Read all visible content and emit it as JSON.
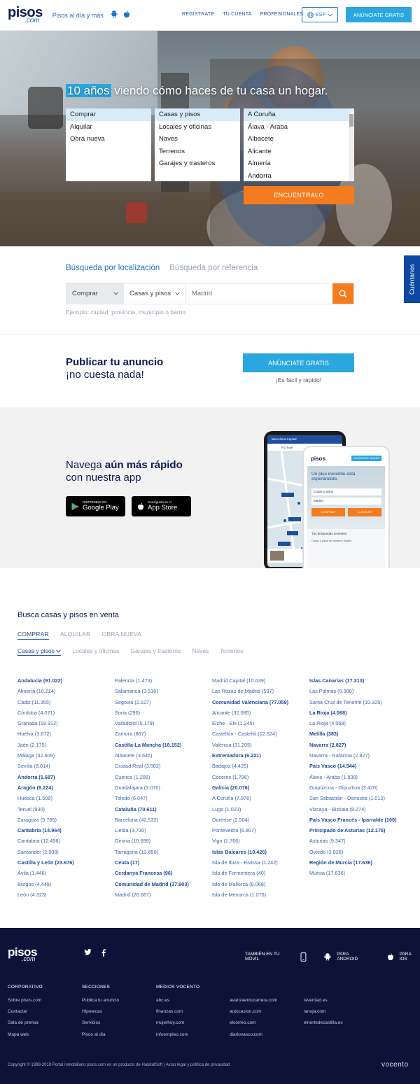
{
  "header": {
    "logo": "pisos",
    "logo_sub": ".com",
    "tagline": "Pisos al día y más",
    "links": [
      "REGÍSTRATE",
      "TU CUENTA",
      "PROFESIONALES"
    ],
    "language": "ESP",
    "cta": "ANÚNCIATE GRATIS"
  },
  "hero": {
    "title_hl": "10 años",
    "title_rest": " viendo cómo haces de tu casa un hogar.",
    "operation_options": [
      "Comprar",
      "Alquilar",
      "Obra nueva"
    ],
    "type_options": [
      "Casas y pisos",
      "Locales y oficinas",
      "Naves",
      "Terrenos",
      "Garajes y trasteros"
    ],
    "province_options": [
      "A Coruña",
      "Álava - Araba",
      "Albacete",
      "Alicante",
      "Almería",
      "Andorra"
    ],
    "find_button": "ENCUÉNTRALO"
  },
  "search": {
    "tab_location_a": "Búsqueda",
    "tab_location_b": " por localización",
    "tab_reference": "Búsqueda por referencia",
    "operation": "Comprar",
    "type": "Casas y pisos",
    "placeholder": "Madrid",
    "hint": "Ejemplo: ciudad, provincia, municipio o barrio"
  },
  "side_tab": "Cuéntanos",
  "publish": {
    "title": "Publicar tu anuncio",
    "subtitle": "¡no cuesta nada!",
    "button": "ANÚNCIATE GRATIS",
    "note": "¡Es fácil y rápido!"
  },
  "app": {
    "line1_a": "Navega ",
    "line1_b": "aún más rápido",
    "line2": "con nuestra app",
    "google_small": "DISPONIBLE EN",
    "google_big": "Google Play",
    "apple_small": "Consíguela en el",
    "apple_big": "App Store",
    "phone_back_search": "Barcelona Capital",
    "phone_back_filter": "FILTRAR",
    "phone_front_logo": "pisos",
    "phone_front_cta": "ANÚNCIATE GRATIS",
    "phone_front_headline": "Un piso increíble está esperándote.",
    "phone_front_type": "Casas y pisos",
    "phone_front_city": "Madrid",
    "phone_front_buy": "COMPRAR",
    "phone_front_rent": "ALQUILAR",
    "phone_front_recent": "Tus búsquedas recientes",
    "phone_front_recent_item": "Casas y pisos en venta en Madrid"
  },
  "listing": {
    "title": "Busca casas y pisos en venta",
    "tabs": [
      "COMPRAR",
      "ALQUILAR",
      "OBRA NUEVA"
    ],
    "subtabs": [
      "Casas y pisos",
      "Locales y oficinas",
      "Garajes y trasteros",
      "Naves",
      "Terrenos"
    ],
    "columns": [
      [
        {
          "t": "Andalucía (91.022)",
          "b": true
        },
        {
          "t": "Almería (10.214)"
        },
        {
          "t": "Cádiz (11.355)"
        },
        {
          "t": "Córdoba (4.071)"
        },
        {
          "t": "Granada (18.912)"
        },
        {
          "t": "Huelva (3.672)"
        },
        {
          "t": "Jaén (2.175)"
        },
        {
          "t": "Málaga (32.609)"
        },
        {
          "t": "Sevilla (8.014)"
        },
        {
          "t": "Andorra (1.687)",
          "b": true
        },
        {
          "t": "Aragón (8.224)",
          "b": true
        },
        {
          "t": "Huesca (1.509)"
        },
        {
          "t": "Teruel (930)"
        },
        {
          "t": "Zaragoza (5.785)"
        },
        {
          "t": "Cantabria (14.964)",
          "b": true
        },
        {
          "t": "Cantabria (12.456)"
        },
        {
          "t": "Santander (2.508)"
        },
        {
          "t": "Castilla y León (23.676)",
          "b": true
        },
        {
          "t": "Ávila (1.446)"
        },
        {
          "t": "Burgos (4.449)"
        },
        {
          "t": "León (4.323)"
        }
      ],
      [
        {
          "t": "Palencia (1.473)"
        },
        {
          "t": "Salamanca (3.516)"
        },
        {
          "t": "Segovia (2.127)"
        },
        {
          "t": "Soria (296)"
        },
        {
          "t": "Valladolid (5.179)"
        },
        {
          "t": "Zamora (867)"
        },
        {
          "t": "Castilla-La Mancha (18.152)",
          "b": true
        },
        {
          "t": "Albacete (3.645)"
        },
        {
          "t": "Ciudad Real (3.582)"
        },
        {
          "t": "Cuenca (1.208)"
        },
        {
          "t": "Guadalajara (3.070)"
        },
        {
          "t": "Toledo (6.647)"
        },
        {
          "t": "Cataluña (70.611)",
          "b": true
        },
        {
          "t": "Barcelona (42.532)"
        },
        {
          "t": "Lleida (3.730)"
        },
        {
          "t": "Girona (10.699)"
        },
        {
          "t": "Tarragona (13.650)"
        },
        {
          "t": "Ceuta (17)",
          "b": true
        },
        {
          "t": "Cerdanya Francesa (96)",
          "b": true
        },
        {
          "t": "Comunidad de Madrid (37.903)",
          "b": true
        },
        {
          "t": "Madrid (26.667)"
        }
      ],
      [
        {
          "t": "Madrid Capital (10.639)"
        },
        {
          "t": "Las Rozas de Madrid (597)"
        },
        {
          "t": "Comunidad Valenciana (77.059)",
          "b": true
        },
        {
          "t": "Alicante (32.085)"
        },
        {
          "t": "Elche - Elx (1.245)"
        },
        {
          "t": "Castellón - Castelló (12.524)"
        },
        {
          "t": "València (31.205)"
        },
        {
          "t": "Extremadura (6.221)",
          "b": true
        },
        {
          "t": "Badajoz (4.425)"
        },
        {
          "t": "Cáceres (1.796)"
        },
        {
          "t": "Galicia (20.076)",
          "b": true
        },
        {
          "t": "A Coruña (7.976)"
        },
        {
          "t": "Lugo (1.023)"
        },
        {
          "t": "Ourense (2.504)"
        },
        {
          "t": "Pontevedra (6.807)"
        },
        {
          "t": "Vigo (1.766)"
        },
        {
          "t": "Islas Baleares (10.426)",
          "b": true
        },
        {
          "t": "Isla de Ibiza - Eivissa (1.242)"
        },
        {
          "t": "Isla de Formentera (40)"
        },
        {
          "t": "Isla de Mallorca (8.068)"
        },
        {
          "t": "Isla de Menorca (1.076)"
        }
      ],
      [
        {
          "t": "Islas Canarias (17.313)",
          "b": true
        },
        {
          "t": "Las Palmas (6.988)"
        },
        {
          "t": "Santa Cruz de Tenerife (10.325)"
        },
        {
          "t": "La Rioja (4.068)",
          "b": true
        },
        {
          "t": "La Rioja (4.068)"
        },
        {
          "t": "Melilla (383)",
          "b": true
        },
        {
          "t": "Navarra (2.827)",
          "b": true
        },
        {
          "t": "Navarra - Nafarroa (2.827)"
        },
        {
          "t": "País Vasco (14.544)",
          "b": true
        },
        {
          "t": "Álava - Araba (1.838)"
        },
        {
          "t": "Guipúzcoa - Gipuzkoa (3.420)"
        },
        {
          "t": "San Sebastián - Donostia (1.012)"
        },
        {
          "t": "Vizcaya - Bizkaia (8.274)"
        },
        {
          "t": "País Vasco Francés - Iparralde (100)",
          "b": true
        },
        {
          "t": "Principado de Asturias (12.175)",
          "b": true
        },
        {
          "t": "Asturias (9.347)"
        },
        {
          "t": "Oviedo (2.828)"
        },
        {
          "t": "Región de Murcia (17.636)",
          "b": true
        },
        {
          "t": "Murcia (17.636)"
        }
      ]
    ]
  },
  "footer": {
    "logo": "pisos",
    "logo_sub": ".com",
    "mobile_label": "TAMBIÉN EN TU MÓVIL",
    "android_label": "PARA ANDROID",
    "ios_label": "PARA IOS",
    "corporativo": {
      "head": "CORPORATIVO",
      "links": [
        "Sobre pisos.com",
        "Contactar",
        "Sala de prensa",
        "Mapa web"
      ]
    },
    "secciones": {
      "head": "SECCIONES",
      "links": [
        "Publica tu anuncio",
        "Hipotecas",
        "Servicios",
        "Pisos al día"
      ]
    },
    "vocento": {
      "head": "MEDIOS VOCENTO",
      "col1": [
        "abc.es",
        "finanzas.com",
        "mujerhoy.com",
        "infoempleo.com"
      ],
      "col2": [
        "avanzaentucarrera.com",
        "autocasion.com",
        "elcorreo.com",
        "diariovasco.com"
      ],
      "col3": [
        "laverdad.es",
        "lanoja.com",
        "elnortedecastilla.es"
      ]
    },
    "copyright": "Copyright © 1998-2019 Portal inmobiliario pisos.com es un producto de HabitatSoft | Aviso legal y política de privacidad",
    "brand": "vocento"
  },
  "colors": {
    "navy": "#0d1b55",
    "accent_blue": "#2aa7df",
    "orange": "#f47c1f",
    "footer_bg": "#0b1339"
  }
}
